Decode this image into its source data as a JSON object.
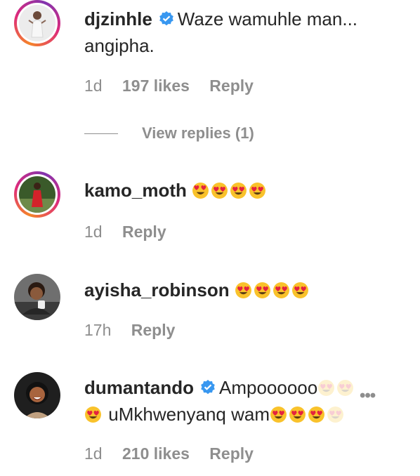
{
  "comments": [
    {
      "username": "djzinhle",
      "verified": true,
      "text_line1": "Waze wamuhle man...",
      "text_line2": "angipha.",
      "time": "1d",
      "likes": "197 likes",
      "reply": "Reply",
      "view_replies": "View replies (1)"
    },
    {
      "username": "kamo_moth",
      "time": "1d",
      "reply": "Reply",
      "emoji_icon": "heart-eyes-emoji"
    },
    {
      "username": "ayisha_robinson",
      "time": "17h",
      "reply": "Reply",
      "emoji_icon": "heart-eyes-emoji"
    },
    {
      "username": "dumantando",
      "verified": true,
      "text_part1": "Ampoooooo",
      "text_part2": "uMkhwenyanq wam",
      "time": "1d",
      "likes": "210 likes",
      "reply": "Reply",
      "more_icon": "more-options-icon"
    }
  ],
  "colors": {
    "text": "#262626",
    "secondary": "#8e8e8e",
    "verified_blue": "#3897f0"
  }
}
